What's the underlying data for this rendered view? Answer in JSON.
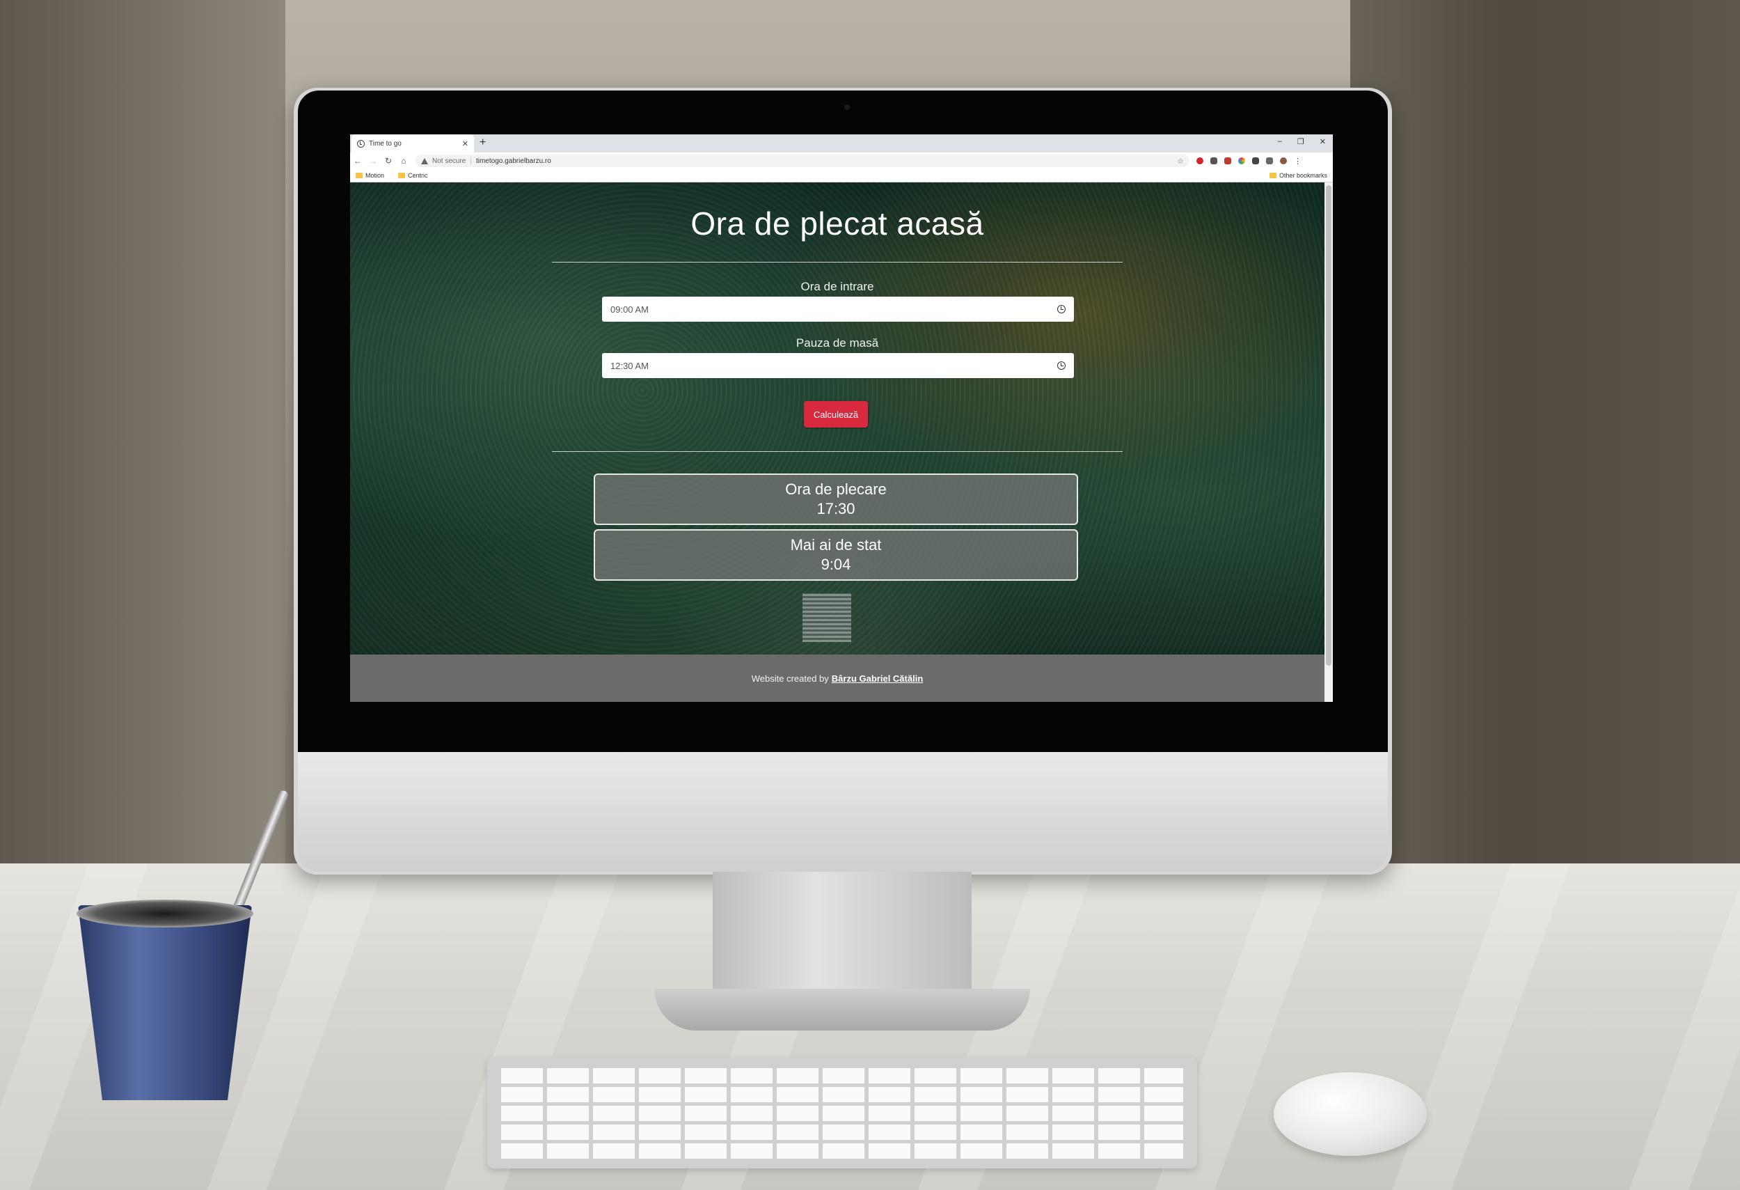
{
  "browser": {
    "tab_title": "Time to go",
    "new_tab": "+",
    "window_controls": [
      "–",
      "❐",
      "✕"
    ],
    "security": "Not secure",
    "url": "timetogo.gabrielbarzu.ro",
    "bookmarks": [
      "Motion",
      "Centric"
    ],
    "other_bookmarks": "Other bookmarks"
  },
  "page": {
    "title": "Ora de plecat acasă",
    "fields": [
      {
        "label": "Ora de intrare",
        "value": "09:00 AM"
      },
      {
        "label": "Pauza de masă",
        "value": "12:30 AM"
      }
    ],
    "button_label": "Calculează",
    "results": [
      {
        "title": "Ora de plecare",
        "value": "17:30"
      },
      {
        "title": "Mai ai de stat",
        "value": "9:04"
      }
    ],
    "footer_text": "Website created by",
    "footer_author": "Bârzu Gabriel Cătălin"
  },
  "colors": {
    "button": "#d9293f",
    "footer_bg": "#6b6b6b"
  }
}
